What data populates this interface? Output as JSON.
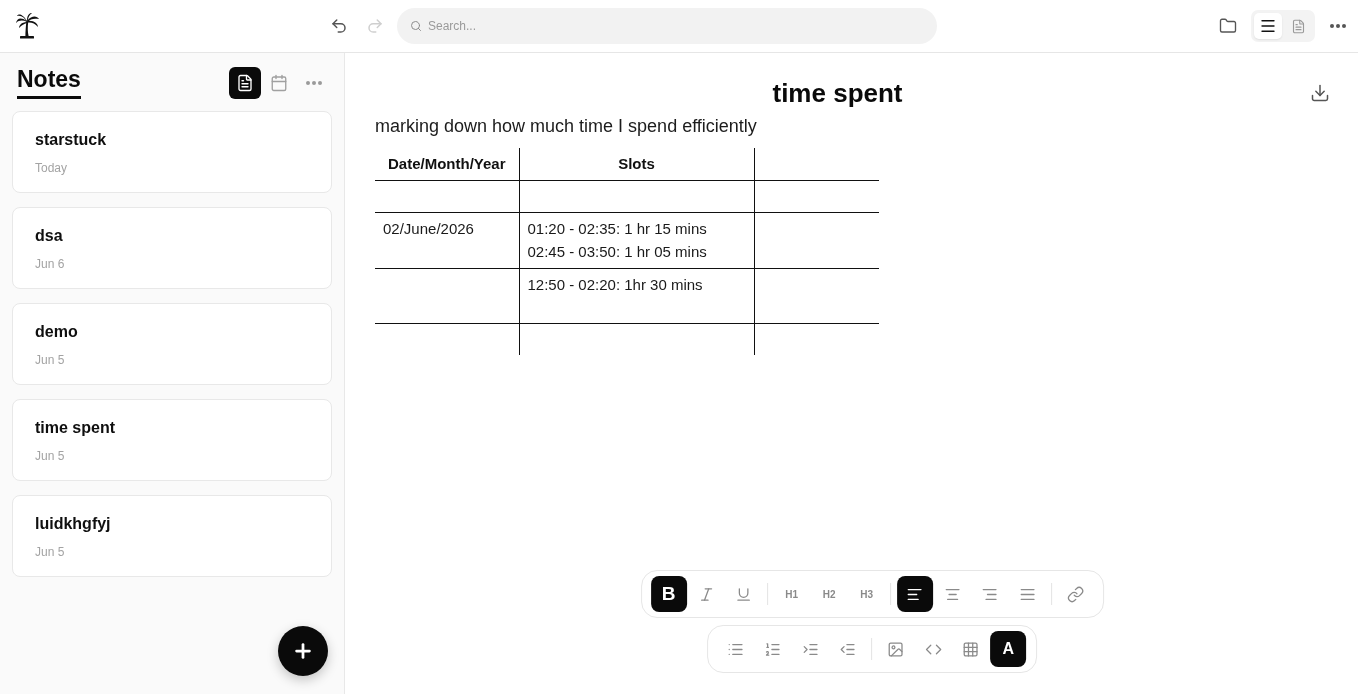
{
  "header": {
    "history": [
      {
        "kind": "undo",
        "disabled": false
      },
      {
        "kind": "redo",
        "disabled": true
      }
    ],
    "search": {
      "placeholder": "Search..."
    },
    "views": [
      {
        "kind": "list",
        "selected": true
      },
      {
        "kind": "page",
        "selected": false
      }
    ]
  },
  "sidebar": {
    "title": "Notes",
    "views": [
      {
        "kind": "notes",
        "selected": true
      },
      {
        "kind": "calendar",
        "selected": false
      }
    ],
    "notes": [
      {
        "title": "starstuck",
        "date": "Today"
      },
      {
        "title": "dsa",
        "date": "Jun 6"
      },
      {
        "title": "demo",
        "date": "Jun 5"
      },
      {
        "title": "time spent",
        "date": "Jun 5"
      },
      {
        "title": "luidkhgfyj",
        "date": "Jun 5"
      }
    ]
  },
  "editor": {
    "title": "time spent",
    "intro": "marking down how much time I spend efficiently",
    "table": {
      "columns": [
        {
          "heading": "Date/Month/Year"
        },
        {
          "heading": "Slots"
        },
        {}
      ],
      "rows": [
        {},
        {
          "date": "02/June/2026",
          "slots": [
            "01:20 - 02:35: 1 hr 15 mins",
            "02:45 - 03:50: 1 hr 05 mins"
          ]
        },
        {
          "slots": [
            "12:50 - 02:20: 1hr 30 mins"
          ]
        },
        {}
      ]
    },
    "toolbars": [
      {
        "groups": [
          [
            {
              "kind": "bold",
              "label": "B",
              "active": true
            },
            {
              "kind": "italic",
              "active": false
            },
            {
              "kind": "underline",
              "active": false
            }
          ],
          [
            {
              "kind": "heading",
              "label": "H1",
              "active": false
            },
            {
              "kind": "heading",
              "label": "H2",
              "active": false
            },
            {
              "kind": "heading",
              "label": "H3",
              "active": false
            }
          ],
          [
            {
              "kind": "left",
              "active": true
            },
            {
              "kind": "center",
              "active": false
            },
            {
              "kind": "right",
              "active": false
            },
            {
              "kind": "justify",
              "active": false
            }
          ],
          [
            {
              "kind": "link",
              "active": false
            }
          ]
        ]
      },
      {
        "groups": [
          [
            {
              "kind": "bullets",
              "active": false
            },
            {
              "kind": "numbers",
              "active": false
            },
            {
              "kind": "indent",
              "active": false
            },
            {
              "kind": "outdent",
              "active": false
            }
          ],
          [
            {
              "kind": "image",
              "active": false
            },
            {
              "kind": "code",
              "active": false
            },
            {
              "kind": "table",
              "active": false
            },
            {
              "kind": "color",
              "label": "A",
              "active": true
            }
          ]
        ]
      }
    ]
  }
}
